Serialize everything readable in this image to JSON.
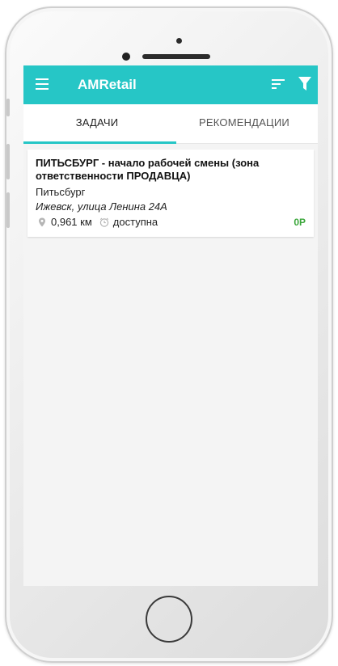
{
  "app": {
    "title": "AMRetail"
  },
  "toolbar": {
    "icons": [
      "menu-icon",
      "sort-icon",
      "filter-icon"
    ]
  },
  "tabs": [
    {
      "label": "ЗАДАЧИ",
      "active": true
    },
    {
      "label": "РЕКОМЕНДАЦИИ",
      "active": false
    }
  ],
  "tasks": [
    {
      "title": "ПИТЬСБУРГ - начало рабочей смены (зона ответственности ПРОДАВЦА)",
      "city": "Питьсбург",
      "address": "Ижевск, улица Ленина 24А",
      "distance": "0,961 км",
      "status": "доступна",
      "score": "0Р"
    }
  ],
  "colors": {
    "accent": "#26c6c6",
    "score": "#3aa63a",
    "background": "#f4f4f4"
  }
}
